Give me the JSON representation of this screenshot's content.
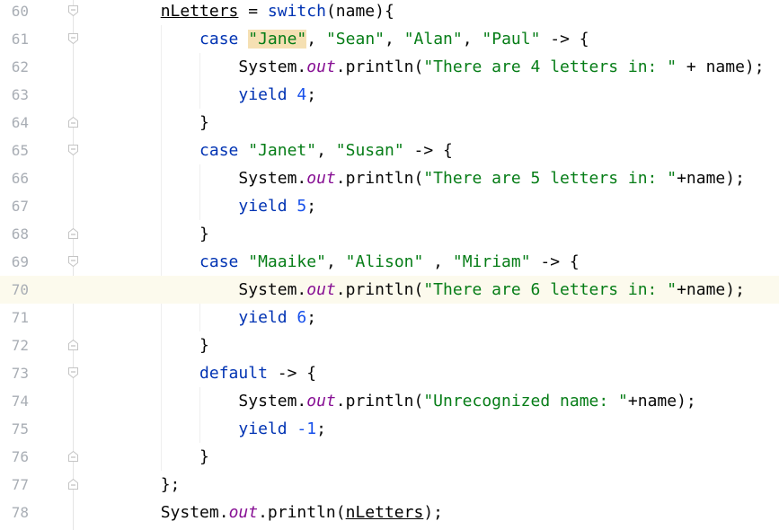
{
  "editor": {
    "lines": [
      {
        "num": "60",
        "fold": "open",
        "tokens": [
          {
            "t": "        "
          },
          {
            "t": "nLetters",
            "c": "var"
          },
          {
            "t": " = "
          },
          {
            "t": "switch",
            "c": "kw"
          },
          {
            "t": "(name){"
          }
        ]
      },
      {
        "num": "61",
        "fold": "open",
        "tokens": [
          {
            "t": "            "
          },
          {
            "t": "case",
            "c": "kw"
          },
          {
            "t": " "
          },
          {
            "t": "\"Jane\"",
            "c": "str hl"
          },
          {
            "t": ", "
          },
          {
            "t": "\"Sean\"",
            "c": "str"
          },
          {
            "t": ", "
          },
          {
            "t": "\"Alan\"",
            "c": "str"
          },
          {
            "t": ", "
          },
          {
            "t": "\"Paul\"",
            "c": "str"
          },
          {
            "t": " -> {"
          }
        ]
      },
      {
        "num": "62",
        "fold": "",
        "tokens": [
          {
            "t": "                System."
          },
          {
            "t": "out",
            "c": "static"
          },
          {
            "t": ".println("
          },
          {
            "t": "\"There are 4 letters in: \"",
            "c": "str"
          },
          {
            "t": " + name);"
          }
        ]
      },
      {
        "num": "63",
        "fold": "",
        "tokens": [
          {
            "t": "                "
          },
          {
            "t": "yield",
            "c": "kw"
          },
          {
            "t": " "
          },
          {
            "t": "4",
            "c": "num"
          },
          {
            "t": ";"
          }
        ]
      },
      {
        "num": "64",
        "fold": "close",
        "tokens": [
          {
            "t": "            }"
          }
        ]
      },
      {
        "num": "65",
        "fold": "open",
        "tokens": [
          {
            "t": "            "
          },
          {
            "t": "case",
            "c": "kw"
          },
          {
            "t": " "
          },
          {
            "t": "\"Janet\"",
            "c": "str"
          },
          {
            "t": ", "
          },
          {
            "t": "\"Susan\"",
            "c": "str"
          },
          {
            "t": " -> {"
          }
        ]
      },
      {
        "num": "66",
        "fold": "",
        "tokens": [
          {
            "t": "                System."
          },
          {
            "t": "out",
            "c": "static"
          },
          {
            "t": ".println("
          },
          {
            "t": "\"There are 5 letters in: \"",
            "c": "str"
          },
          {
            "t": "+name);"
          }
        ]
      },
      {
        "num": "67",
        "fold": "",
        "tokens": [
          {
            "t": "                "
          },
          {
            "t": "yield",
            "c": "kw"
          },
          {
            "t": " "
          },
          {
            "t": "5",
            "c": "num"
          },
          {
            "t": ";"
          }
        ]
      },
      {
        "num": "68",
        "fold": "close",
        "tokens": [
          {
            "t": "            }"
          }
        ]
      },
      {
        "num": "69",
        "fold": "open",
        "tokens": [
          {
            "t": "            "
          },
          {
            "t": "case",
            "c": "kw"
          },
          {
            "t": " "
          },
          {
            "t": "\"Maaike\"",
            "c": "str"
          },
          {
            "t": ", "
          },
          {
            "t": "\"Alison\"",
            "c": "str"
          },
          {
            "t": " , "
          },
          {
            "t": "\"Miriam\"",
            "c": "str"
          },
          {
            "t": " -> {"
          }
        ]
      },
      {
        "num": "70",
        "fold": "",
        "current": true,
        "tokens": [
          {
            "t": "                System."
          },
          {
            "t": "out",
            "c": "static"
          },
          {
            "t": ".println("
          },
          {
            "t": "\"There are 6 letters in: \"",
            "c": "str"
          },
          {
            "t": "+name);"
          }
        ]
      },
      {
        "num": "71",
        "fold": "",
        "tokens": [
          {
            "t": "                "
          },
          {
            "t": "yield",
            "c": "kw"
          },
          {
            "t": " "
          },
          {
            "t": "6",
            "c": "num"
          },
          {
            "t": ";"
          }
        ]
      },
      {
        "num": "72",
        "fold": "close",
        "tokens": [
          {
            "t": "            }"
          }
        ]
      },
      {
        "num": "73",
        "fold": "open",
        "tokens": [
          {
            "t": "            "
          },
          {
            "t": "default",
            "c": "kw"
          },
          {
            "t": " -> {"
          }
        ]
      },
      {
        "num": "74",
        "fold": "",
        "tokens": [
          {
            "t": "                System."
          },
          {
            "t": "out",
            "c": "static"
          },
          {
            "t": ".println("
          },
          {
            "t": "\"Unrecognized name: \"",
            "c": "str"
          },
          {
            "t": "+name);"
          }
        ]
      },
      {
        "num": "75",
        "fold": "",
        "tokens": [
          {
            "t": "                "
          },
          {
            "t": "yield",
            "c": "kw"
          },
          {
            "t": " "
          },
          {
            "t": "-1",
            "c": "num"
          },
          {
            "t": ";"
          }
        ]
      },
      {
        "num": "76",
        "fold": "close",
        "tokens": [
          {
            "t": "            }"
          }
        ]
      },
      {
        "num": "77",
        "fold": "close",
        "tokens": [
          {
            "t": "        };"
          }
        ]
      },
      {
        "num": "78",
        "fold": "",
        "tokens": [
          {
            "t": "        System."
          },
          {
            "t": "out",
            "c": "static"
          },
          {
            "t": ".println("
          },
          {
            "t": "nLetters",
            "c": "var"
          },
          {
            "t": ");"
          }
        ]
      }
    ],
    "colors": {
      "keyword": "#0033b3",
      "string": "#067d17",
      "number": "#1750eb",
      "static_field": "#871094",
      "line_number": "#a9aeb5",
      "current_line": "#fcfaed",
      "match_highlight": "#f5e0b3"
    }
  }
}
